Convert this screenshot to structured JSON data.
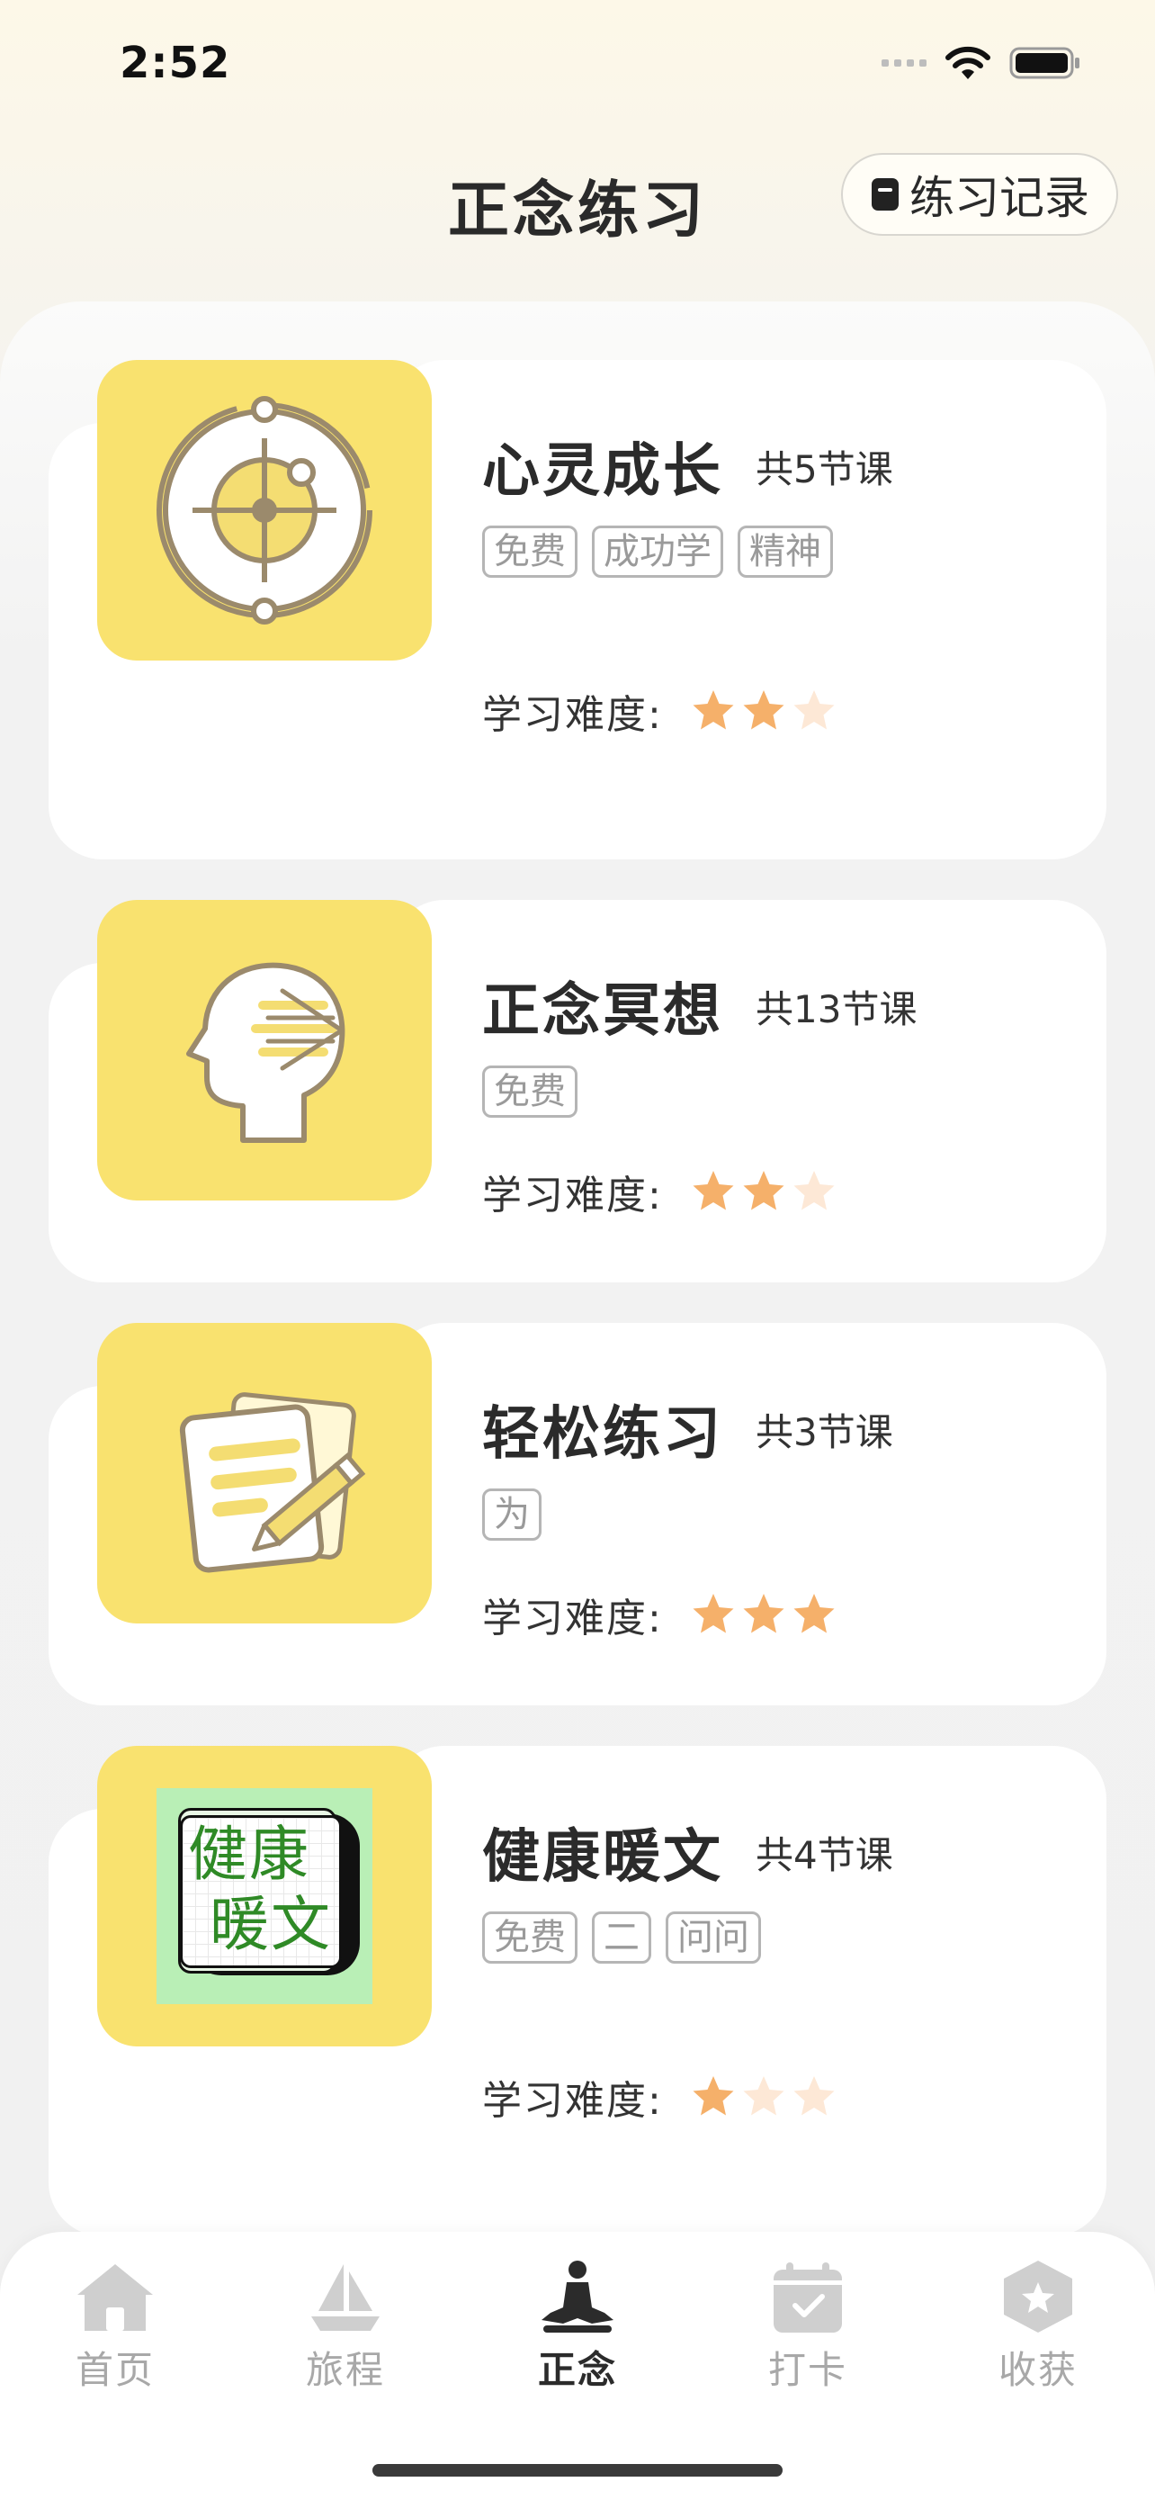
{
  "status_bar": {
    "time": "2:52"
  },
  "header": {
    "title": "正念练习",
    "record_button": "练习记录"
  },
  "courses": [
    {
      "title": "心灵成长",
      "lessons": "共5节课",
      "tags": [
        "免费",
        "成功学",
        "精神"
      ],
      "difficulty_label": "学习难度:",
      "difficulty": 2,
      "difficulty_max": 3,
      "icon": "compass-target-icon"
    },
    {
      "title": "正念冥想",
      "lessons": "共13节课",
      "tags": [
        "免费"
      ],
      "difficulty_label": "学习难度:",
      "difficulty": 2,
      "difficulty_max": 3,
      "icon": "head-meditation-icon"
    },
    {
      "title": "轻松练习",
      "lessons": "共3节课",
      "tags": [
        "为"
      ],
      "difficulty_label": "学习难度:",
      "difficulty": 3,
      "difficulty_max": 3,
      "icon": "notes-pencil-icon"
    },
    {
      "title": "健康暖文",
      "lessons": "共4节课",
      "tags": [
        "免费",
        "二",
        "问问"
      ],
      "difficulty_label": "学习难度:",
      "difficulty": 1,
      "difficulty_max": 3,
      "icon": "health-article-image",
      "thumb_text": [
        "健康",
        "暖文"
      ]
    }
  ],
  "tab_bar": {
    "tabs": [
      {
        "label": "首页",
        "icon": "home-icon"
      },
      {
        "label": "旅程",
        "icon": "sailboat-icon"
      },
      {
        "label": "正念",
        "icon": "meditation-icon",
        "active": true
      },
      {
        "label": "打卡",
        "icon": "calendar-check-icon"
      },
      {
        "label": "收获",
        "icon": "hexagon-star-icon"
      }
    ]
  },
  "colors": {
    "accent_yellow": "#f9e26f",
    "star_filled": "#f5b06a",
    "star_empty": "#fde8d6",
    "active_tab": "#2b2b2b",
    "inactive_tab": "#a8a8a8"
  }
}
